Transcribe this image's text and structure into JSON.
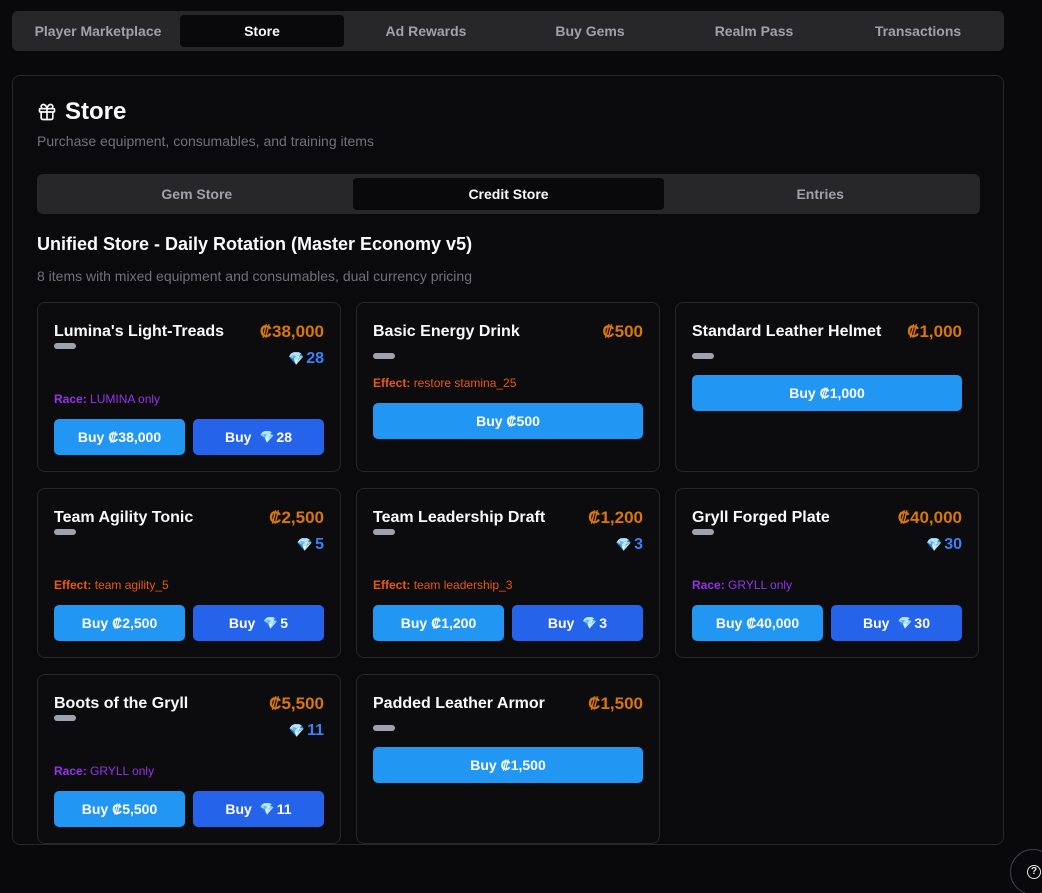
{
  "nav": {
    "tabs": [
      {
        "label": "Player Marketplace",
        "active": false
      },
      {
        "label": "Store",
        "active": true
      },
      {
        "label": "Ad Rewards",
        "active": false
      },
      {
        "label": "Buy Gems",
        "active": false
      },
      {
        "label": "Realm Pass",
        "active": false
      },
      {
        "label": "Transactions",
        "active": false
      }
    ]
  },
  "store": {
    "icon": "gift-icon",
    "title": "Store",
    "subtitle": "Purchase equipment, consumables, and training items",
    "subtabs": [
      {
        "label": "Gem Store",
        "active": false
      },
      {
        "label": "Credit Store",
        "active": true
      },
      {
        "label": "Entries",
        "active": false
      }
    ],
    "section_title": "Unified Store - Daily Rotation (Master Economy v5)",
    "section_subtitle": "8 items with mixed equipment and consumables, dual currency pricing"
  },
  "gem_glyph": "💎",
  "colors": {
    "credit": "#d97706",
    "gem": "#3b82f6",
    "race": "#9333ea",
    "effect": "#ea580c",
    "button": "#2196f3"
  },
  "items": [
    {
      "name": "Lumina's Light-Treads",
      "credit_price": "₡38,000",
      "gem_price": "28",
      "meta_label": "Race:",
      "meta_value": "LUMINA only",
      "meta_type": "race",
      "buy_credit": "Buy ₡38,000",
      "buy_gem_label": "Buy",
      "buy_gem_value": "28"
    },
    {
      "name": "Basic Energy Drink",
      "credit_price": "₡500",
      "gem_price": null,
      "meta_label": "Effect:",
      "meta_value": "restore stamina_25",
      "meta_type": "effect",
      "buy_credit": "Buy ₡500",
      "buy_gem_label": null,
      "buy_gem_value": null
    },
    {
      "name": "Standard Leather Helmet",
      "credit_price": "₡1,000",
      "gem_price": null,
      "meta_label": null,
      "meta_value": null,
      "meta_type": null,
      "buy_credit": "Buy ₡1,000",
      "buy_gem_label": null,
      "buy_gem_value": null
    },
    {
      "name": "Team Agility Tonic",
      "credit_price": "₡2,500",
      "gem_price": "5",
      "meta_label": "Effect:",
      "meta_value": "team agility_5",
      "meta_type": "effect",
      "buy_credit": "Buy ₡2,500",
      "buy_gem_label": "Buy",
      "buy_gem_value": "5"
    },
    {
      "name": "Team Leadership Draft",
      "credit_price": "₡1,200",
      "gem_price": "3",
      "meta_label": "Effect:",
      "meta_value": "team leadership_3",
      "meta_type": "effect",
      "buy_credit": "Buy ₡1,200",
      "buy_gem_label": "Buy",
      "buy_gem_value": "3"
    },
    {
      "name": "Gryll Forged Plate",
      "credit_price": "₡40,000",
      "gem_price": "30",
      "meta_label": "Race:",
      "meta_value": "GRYLL only",
      "meta_type": "race",
      "buy_credit": "Buy ₡40,000",
      "buy_gem_label": "Buy",
      "buy_gem_value": "30"
    },
    {
      "name": "Boots of the Gryll",
      "credit_price": "₡5,500",
      "gem_price": "11",
      "meta_label": "Race:",
      "meta_value": "GRYLL only",
      "meta_type": "race",
      "buy_credit": "Buy ₡5,500",
      "buy_gem_label": "Buy",
      "buy_gem_value": "11"
    },
    {
      "name": "Padded Leather Armor",
      "credit_price": "₡1,500",
      "gem_price": null,
      "meta_label": null,
      "meta_value": null,
      "meta_type": null,
      "buy_credit": "Buy ₡1,500",
      "buy_gem_label": null,
      "buy_gem_value": null
    }
  ],
  "help": {
    "icon": "help-circle-icon",
    "glyph": "?"
  }
}
